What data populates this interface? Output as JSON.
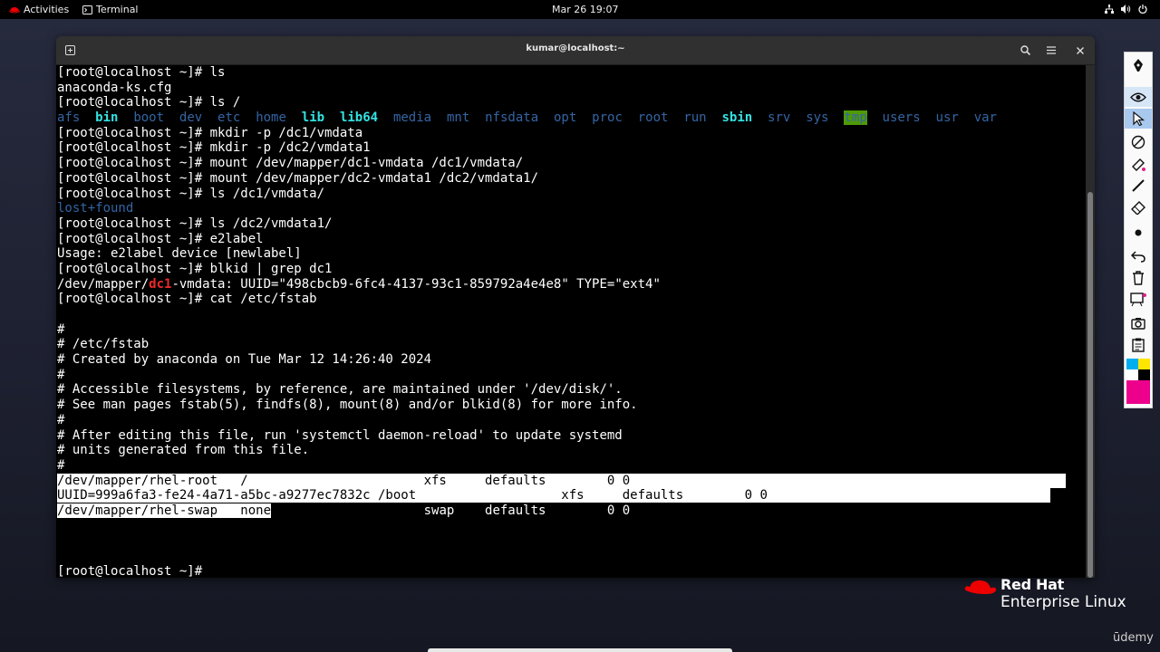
{
  "topbar": {
    "activities": "Activities",
    "app_name": "Terminal",
    "clock": "Mar 26  19:07"
  },
  "window": {
    "title": "kumar@localhost:~"
  },
  "terminal": {
    "lines": [
      [
        {
          "t": "[root@localhost ~]# ls"
        }
      ],
      [
        {
          "t": "anaconda-ks.cfg"
        }
      ],
      [
        {
          "t": "[root@localhost ~]# ls /"
        }
      ],
      [
        {
          "t": "afs",
          "c": "blue"
        },
        {
          "t": "  "
        },
        {
          "t": "bin",
          "c": "cyan"
        },
        {
          "t": "  "
        },
        {
          "t": "boot",
          "c": "blue"
        },
        {
          "t": "  "
        },
        {
          "t": "dev",
          "c": "blue"
        },
        {
          "t": "  "
        },
        {
          "t": "etc",
          "c": "blue"
        },
        {
          "t": "  "
        },
        {
          "t": "home",
          "c": "blue"
        },
        {
          "t": "  "
        },
        {
          "t": "lib",
          "c": "cyan"
        },
        {
          "t": "  "
        },
        {
          "t": "lib64",
          "c": "cyan"
        },
        {
          "t": "  "
        },
        {
          "t": "media",
          "c": "blue"
        },
        {
          "t": "  "
        },
        {
          "t": "mnt",
          "c": "blue"
        },
        {
          "t": "  "
        },
        {
          "t": "nfsdata",
          "c": "blue"
        },
        {
          "t": "  "
        },
        {
          "t": "opt",
          "c": "blue"
        },
        {
          "t": "  "
        },
        {
          "t": "proc",
          "c": "blue"
        },
        {
          "t": "  "
        },
        {
          "t": "root",
          "c": "blue"
        },
        {
          "t": "  "
        },
        {
          "t": "run",
          "c": "blue"
        },
        {
          "t": "  "
        },
        {
          "t": "sbin",
          "c": "cyan"
        },
        {
          "t": "  "
        },
        {
          "t": "srv",
          "c": "blue"
        },
        {
          "t": "  "
        },
        {
          "t": "sys",
          "c": "blue"
        },
        {
          "t": "  "
        },
        {
          "t": "tmp",
          "c": "tmpbg"
        },
        {
          "t": "  "
        },
        {
          "t": "users",
          "c": "blue"
        },
        {
          "t": "  "
        },
        {
          "t": "usr",
          "c": "blue"
        },
        {
          "t": "  "
        },
        {
          "t": "var",
          "c": "blue"
        }
      ],
      [
        {
          "t": "[root@localhost ~]# mkdir -p /dc1/vmdata"
        }
      ],
      [
        {
          "t": "[root@localhost ~]# mkdir -p /dc2/vmdata1"
        }
      ],
      [
        {
          "t": "[root@localhost ~]# mount /dev/mapper/dc1-vmdata /dc1/vmdata/"
        }
      ],
      [
        {
          "t": "[root@localhost ~]# mount /dev/mapper/dc2-vmdata1 /dc2/vmdata1/"
        }
      ],
      [
        {
          "t": "[root@localhost ~]# ls /dc1/vmdata/"
        }
      ],
      [
        {
          "t": "lost+found",
          "c": "blue"
        }
      ],
      [
        {
          "t": "[root@localhost ~]# ls /dc2/vmdata1/"
        }
      ],
      [
        {
          "t": "[root@localhost ~]# e2label"
        }
      ],
      [
        {
          "t": "Usage: e2label device [newlabel]"
        }
      ],
      [
        {
          "t": "[root@localhost ~]# blkid | grep dc1"
        }
      ],
      [
        {
          "t": "/dev/mapper/"
        },
        {
          "t": "dc1",
          "c": "red"
        },
        {
          "t": "-vmdata: UUID=\"498cbcb9-6fc4-4137-93c1-859792a4e4e8\" TYPE=\"ext4\""
        }
      ],
      [
        {
          "t": "[root@localhost ~]# cat /etc/fstab"
        }
      ],
      [
        {
          "t": ""
        }
      ],
      [
        {
          "t": "#"
        }
      ],
      [
        {
          "t": "# /etc/fstab"
        }
      ],
      [
        {
          "t": "# Created by anaconda on Tue Mar 12 14:26:40 2024"
        }
      ],
      [
        {
          "t": "#"
        }
      ],
      [
        {
          "t": "# Accessible filesystems, by reference, are maintained under '/dev/disk/'."
        }
      ],
      [
        {
          "t": "# See man pages fstab(5), findfs(8), mount(8) and/or blkid(8) for more info."
        }
      ],
      [
        {
          "t": "#"
        }
      ],
      [
        {
          "t": "# After editing this file, run 'systemctl daemon-reload' to update systemd"
        }
      ],
      [
        {
          "t": "# units generated from this file."
        }
      ],
      [
        {
          "t": "#"
        }
      ],
      [
        {
          "t": "/dev/mapper/rhel-root   /                       xfs     defaults        0 0                                                         ",
          "c": "sel"
        }
      ],
      [
        {
          "t": "UUID=999a6fa3-fe24-4a71-a5bc-a9277ec7832c /boot                   xfs     defaults        0 0                                     ",
          "c": "sel"
        }
      ],
      [
        {
          "t": "/dev/mapper/rhel-swap   none",
          "c": "sel"
        },
        {
          "t": "                    swap    defaults        0 0"
        }
      ],
      [
        {
          "t": ""
        }
      ],
      [
        {
          "t": ""
        }
      ],
      [
        {
          "t": ""
        }
      ],
      [
        {
          "t": "[root@localhost ~]# "
        }
      ]
    ]
  },
  "branding": {
    "line1": "Red Hat",
    "line2": "Enterprise Linux",
    "watermark": "ūdemy"
  },
  "colors": {
    "prompt_text": "#ffffff",
    "dir_blue": "#3465a4",
    "exec_cyan": "#34e2e2",
    "match_red": "#ef2929",
    "redhat_red": "#ee0000"
  },
  "tools": [
    "pen-icon",
    "eye-icon",
    "pointer-icon",
    "no-draw-icon",
    "highlighter-icon",
    "marker-icon",
    "line-icon",
    "eraser-icon",
    "dot-icon",
    "undo-icon",
    "trash-icon",
    "whiteboard-icon",
    "camera-icon",
    "clipboard-icon",
    "color-palette-icon"
  ]
}
